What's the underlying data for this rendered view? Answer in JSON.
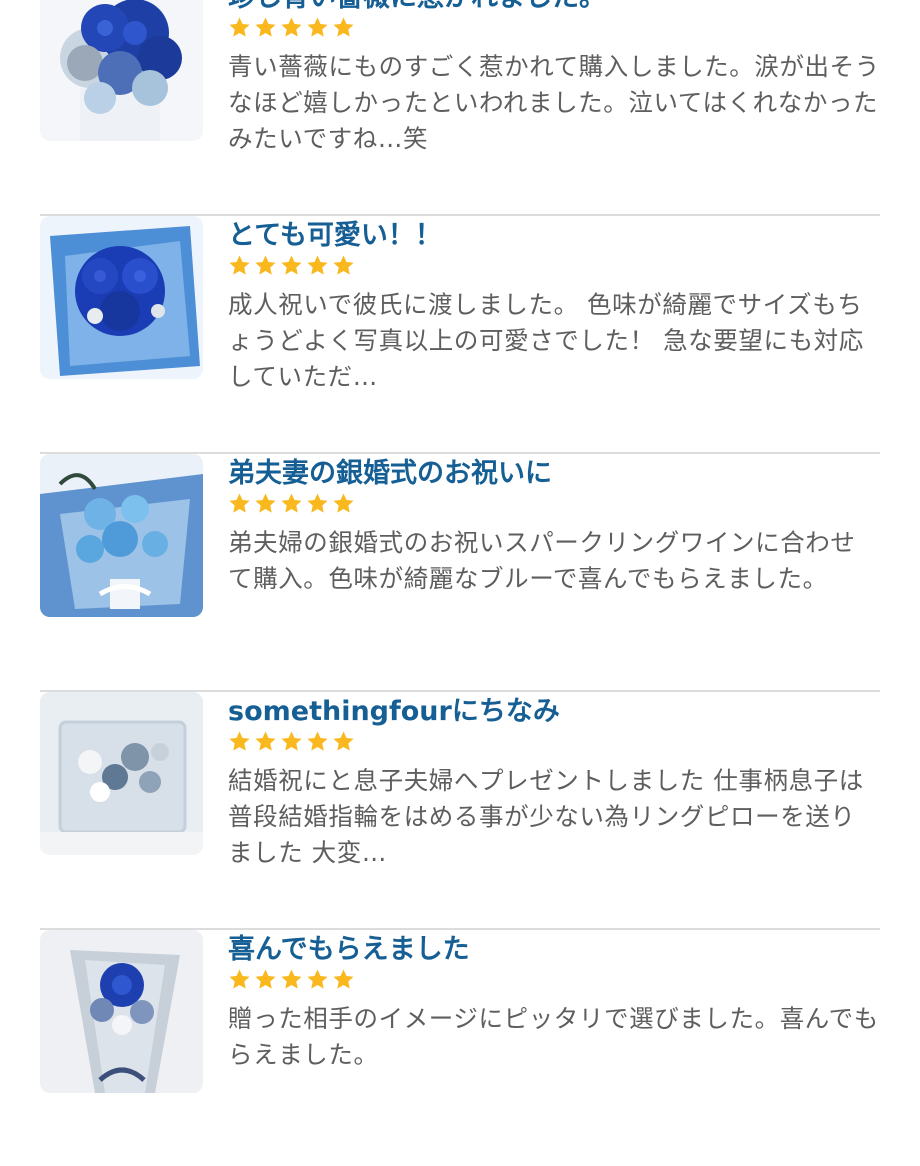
{
  "colors": {
    "title": "#165f95",
    "text": "#5e5e5e",
    "star": "#f9b81e",
    "divider": "#dcdcdc"
  },
  "reviews": [
    {
      "title": "珍し青い薔薇に惹かれました。",
      "rating": 5,
      "body": "青い薔薇にものすごく惹かれて購入しました。涙が出そうなほど嬉しかったといわれました。泣いてはくれなかったみたいですね…笑",
      "image_icon": "blue-rose-arrangement-image"
    },
    {
      "title": "とても可愛い！！",
      "rating": 5,
      "body": "成人祝いで彼氏に渡しました。 色味が綺麗でサイズもちょうどよく写真以上の可愛さでした！ 急な要望にも対応していただ…",
      "image_icon": "blue-rose-bouquet-image"
    },
    {
      "title": "弟夫妻の銀婚式のお祝いに",
      "rating": 5,
      "body": "弟夫婦の銀婚式のお祝いスパークリングワインに合わせて購入。色味が綺麗なブルーで喜んでもらえました。",
      "image_icon": "light-blue-bouquet-image"
    },
    {
      "title": "somethingfourにちなみ",
      "rating": 5,
      "body": "結婚祝にと息子夫婦へプレゼントしました 仕事柄息子は普段結婚指輪をはめる事が少ない為リングピローを送りました 大変…",
      "image_icon": "ring-pillow-image"
    },
    {
      "title": "喜んでもらえました",
      "rating": 5,
      "body": "贈った相手のイメージにピッタリで選びました。喜んでもらえました。",
      "image_icon": "single-rose-bouquet-image"
    }
  ]
}
